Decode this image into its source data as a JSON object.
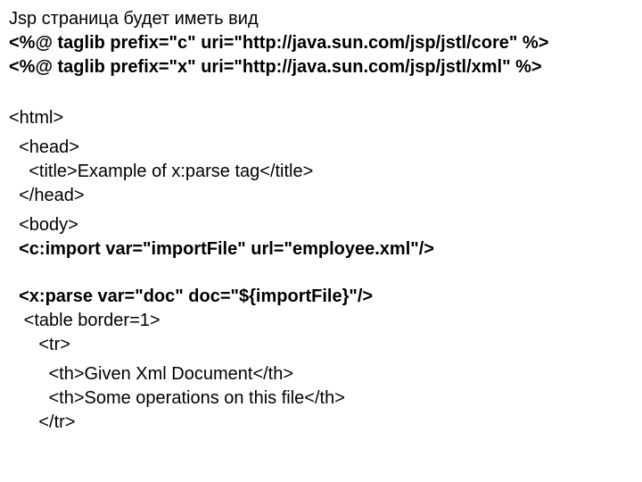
{
  "lines": {
    "l01": "Jsp страница будет иметь вид",
    "l02": "<%@ taglib prefix=\"c\" uri=\"http://java.sun.com/jsp/jstl/core\" %>",
    "l03": "<%@ taglib prefix=\"x\" uri=\"http://java.sun.com/jsp/jstl/xml\" %>",
    "l04": "<html>",
    "l05": "  <head>",
    "l06": "    <title>Example of x:parse tag</title>",
    "l07": "  </head>",
    "l08": "  <body>",
    "l09": "  <c:import var=\"importFile\" url=\"employee.xml\"/>",
    "l10": "  <x:parse var=\"doc\" doc=\"${importFile}\"/>",
    "l11": "   <table border=1>",
    "l12": "      <tr>",
    "l13": "        <th>Given Xml Document</th>",
    "l14": "        <th>Some operations on this file</th>",
    "l15": "      </tr>"
  }
}
